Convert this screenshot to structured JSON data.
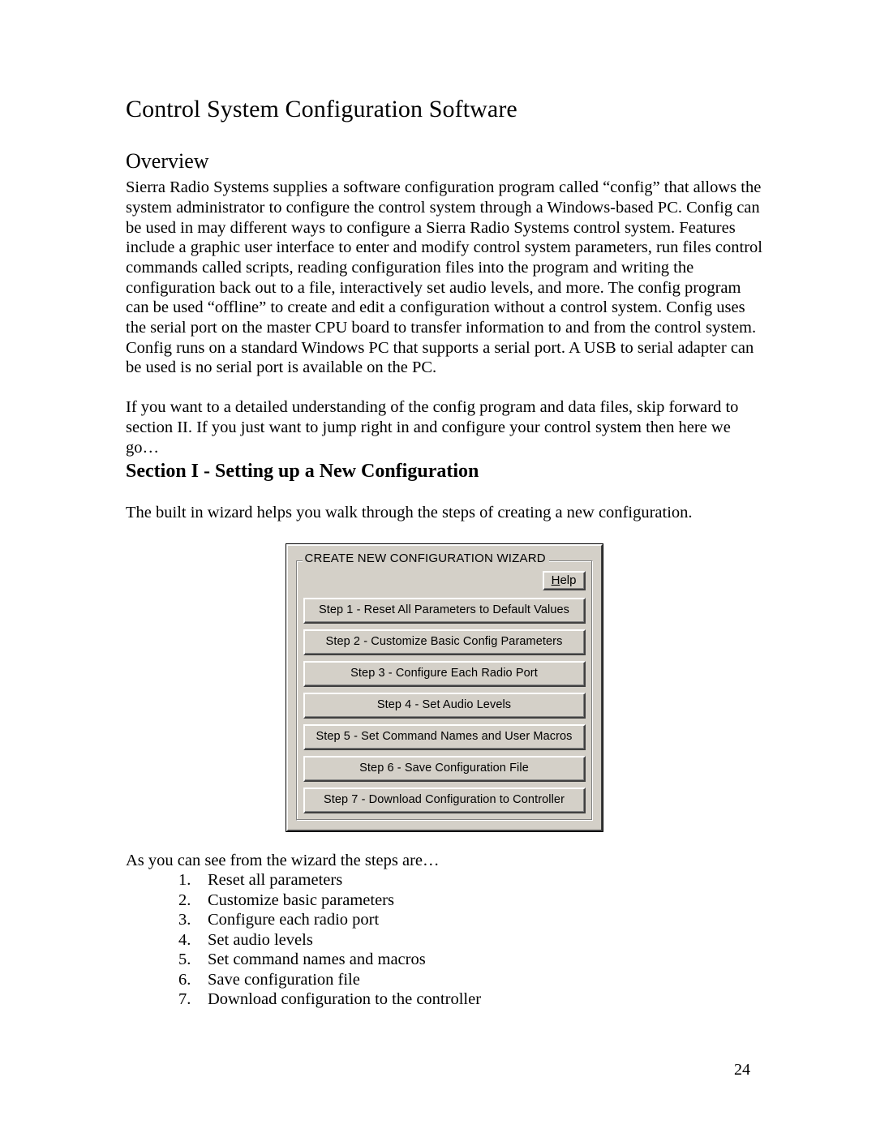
{
  "document": {
    "title": "Control System Configuration Software",
    "overview_heading": "Overview",
    "overview_paragraph": "Sierra Radio Systems supplies a software configuration program called “config” that allows the system administrator to configure the control system through a Windows-based PC.  Config can be used in may different ways to configure a Sierra Radio Systems control system.  Features include a graphic user interface to enter and modify control system parameters, run files control commands called scripts, reading configuration files into the program and writing the configuration back out to a file, interactively set audio levels, and more.  The config program can be used “offline” to create and edit a configuration without a control system.  Config uses the serial port on the master CPU board to transfer information to and from the control system.  Config runs on a standard Windows PC that supports a serial port.  A USB to serial adapter can be used is no serial port is available on the PC.",
    "skip_paragraph": "If you want to a detailed understanding of the config program and data files, skip forward to section II.  If you just want to jump right in and configure your control system then here we go…",
    "section_heading": "Section I - Setting up a New Configuration",
    "wizard_intro": "The built in wizard helps you walk through the steps of creating a new configuration.",
    "steps_intro": "As you can see from the wizard the steps are…",
    "page_number": "24"
  },
  "wizard": {
    "legend": "CREATE NEW CONFIGURATION WIZARD",
    "help_button": {
      "accel": "H",
      "rest": "elp"
    },
    "steps": [
      {
        "label": "Step 1 - Reset All Parameters to Default Values"
      },
      {
        "label": "Step 2 - Customize Basic Config Parameters"
      },
      {
        "label": "Step 3 - Configure Each Radio Port"
      },
      {
        "label": "Step 4 - Set Audio Levels"
      },
      {
        "label": "Step 5 - Set Command Names and User Macros"
      },
      {
        "label": "Step 6 - Save Configuration File"
      },
      {
        "label": "Step 7 - Download Configuration to Controller"
      }
    ]
  },
  "steps_list": [
    {
      "marker": "1.",
      "text": "Reset all parameters"
    },
    {
      "marker": "2.",
      "text": "Customize basic parameters"
    },
    {
      "marker": "3.",
      "text": "Configure each radio port"
    },
    {
      "marker": "4.",
      "text": "Set audio levels"
    },
    {
      "marker": "5.",
      "text": "Set command names and macros"
    },
    {
      "marker": "6.",
      "text": "Save configuration file"
    },
    {
      "marker": "7.",
      "text": "Download configuration to the controller"
    }
  ],
  "colors": {
    "page_background": "#ffffff",
    "text": "#000000",
    "dialog_face": "#d4d0c8",
    "dialog_highlight": "#ffffff",
    "dialog_shadow": "#404040",
    "dialog_mid_shadow": "#808080"
  }
}
